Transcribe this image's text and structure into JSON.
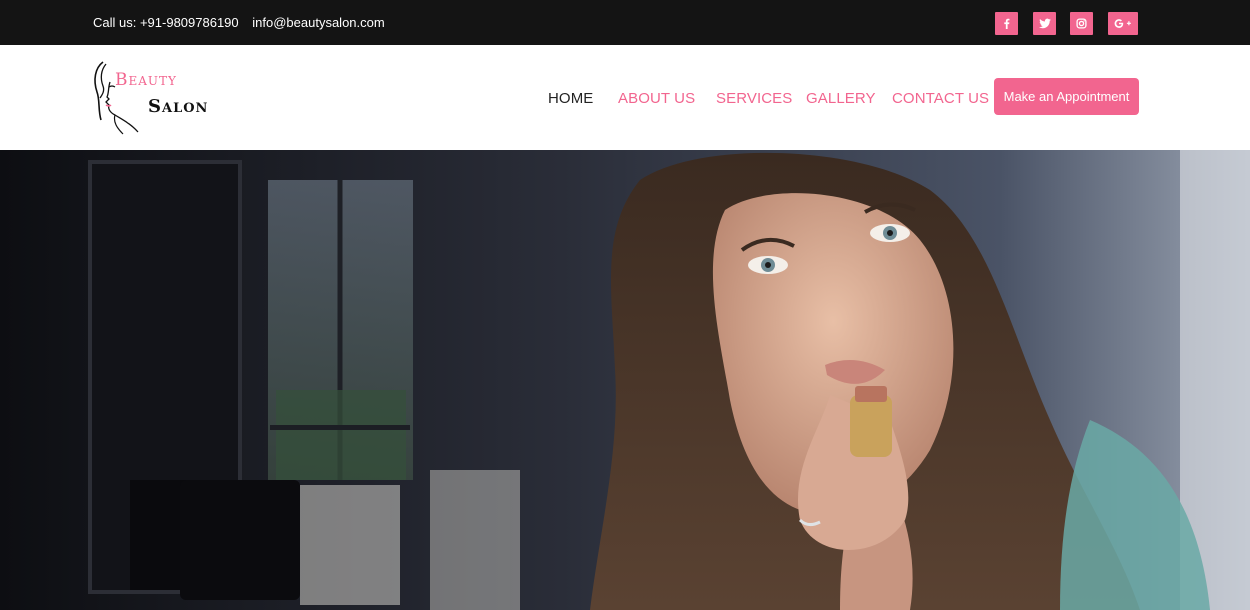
{
  "topbar": {
    "phone": "Call us: +91-9809786190",
    "email": "info@beautysalon.com",
    "social": [
      "facebook-icon",
      "twitter-icon",
      "instagram-icon",
      "google-plus-icon"
    ]
  },
  "logo": {
    "word1": "Beauty",
    "word2": "Salon"
  },
  "nav": {
    "items": [
      "HOME",
      "ABOUT US",
      "SERVICES",
      "GALLERY",
      "CONTACT US"
    ],
    "active": "HOME"
  },
  "cta": {
    "label": "Make an Appointment"
  },
  "hero": {
    "image": "woman applying lipstick in a salon"
  },
  "colors": {
    "accent": "#f2658f",
    "topbar_bg": "#141414",
    "nav_active": "#222222"
  }
}
